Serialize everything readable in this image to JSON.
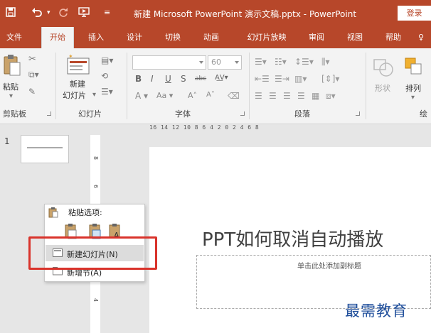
{
  "window": {
    "title": "新建 Microsoft PowerPoint 演示文稿.pptx - PowerPoint",
    "login_label": "登录"
  },
  "tabs": [
    "文件",
    "开始",
    "插入",
    "设计",
    "切换",
    "动画",
    "幻灯片放映",
    "审阅",
    "视图",
    "帮助",
    "♀"
  ],
  "active_tab": "开始",
  "ribbon": {
    "paste_label": "粘贴",
    "clipboard_group": "剪贴板",
    "new_slide_label_1": "新建",
    "new_slide_label_2": "幻灯片",
    "slides_group": "幻灯片",
    "font_size_value": "60",
    "font_group": "字体",
    "paragraph_group": "段落",
    "shape_label": "形状",
    "arrange_label": "排列",
    "drawing_group": "绘"
  },
  "ruler": {
    "horizontal_text": "16 14 12 10 8 6 4 2 0 2 4 6 8",
    "vertical_ticks": [
      "8",
      "6",
      "4"
    ]
  },
  "thumbnails": {
    "slide_number": "1"
  },
  "slide": {
    "title": "PPT如何取消自动播放",
    "subtitle_placeholder": "单击此处添加副标题"
  },
  "context_menu": {
    "paste_options_label": "粘贴选项:",
    "items": [
      {
        "label": "新建幻灯片(N)",
        "highlighted": true
      },
      {
        "label": "新增节(A)",
        "highlighted": false
      }
    ]
  },
  "watermark": "最需教育",
  "colors": {
    "brand": "#b7472a",
    "highlight_box": "#d9332b",
    "watermark": "#1f4e9b"
  }
}
